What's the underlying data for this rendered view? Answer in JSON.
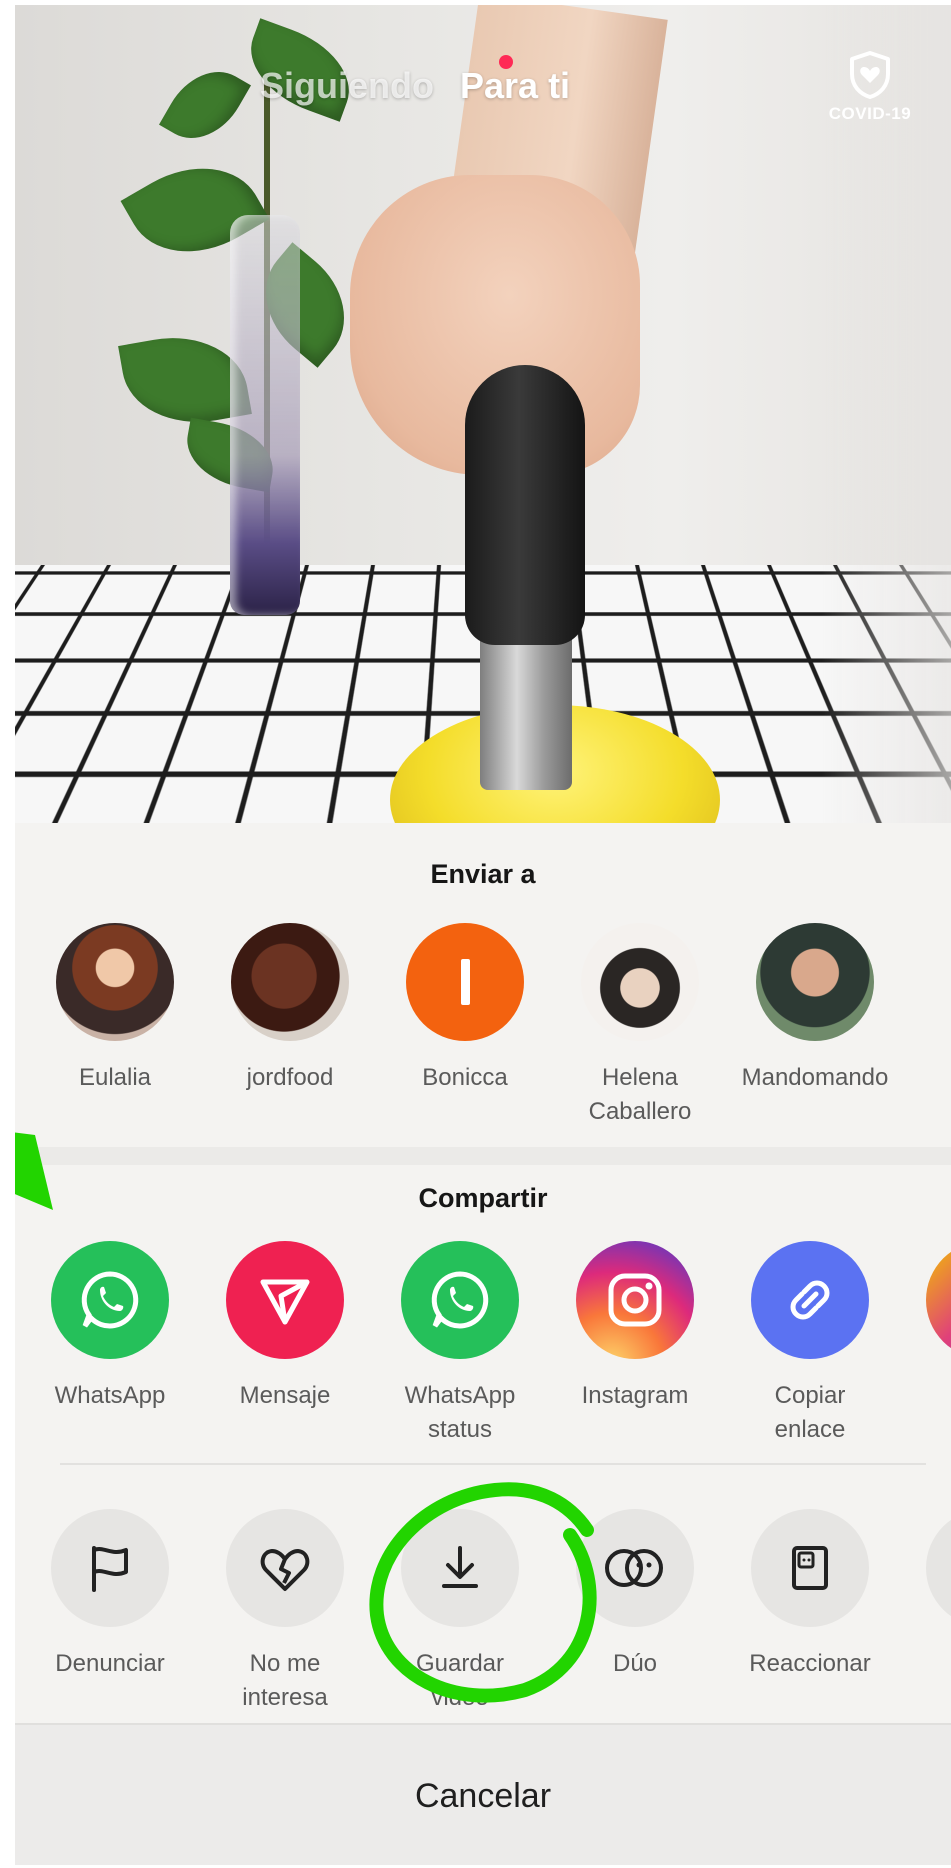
{
  "top_nav": {
    "following": "Siguiendo",
    "for_you": "Para ti",
    "covid_label": "COVID-19"
  },
  "share_sheet": {
    "send_to_title": "Enviar a",
    "contacts": [
      {
        "name": "Eulalia"
      },
      {
        "name": "jordfood"
      },
      {
        "name": "Bonicca"
      },
      {
        "name": "Helena Caballero"
      },
      {
        "name": "Mandomando"
      }
    ],
    "share_title": "Compartir",
    "share_apps": [
      {
        "label": "WhatsApp",
        "icon": "whatsapp-icon",
        "color": "#25c05a"
      },
      {
        "label": "Mensaje",
        "icon": "send-message-icon",
        "color": "#ef2151"
      },
      {
        "label": "WhatsApp status",
        "icon": "whatsapp-icon",
        "color": "#25c05a"
      },
      {
        "label": "Instagram",
        "icon": "instagram-icon",
        "color": "#d6249f"
      },
      {
        "label": "Copiar enlace",
        "icon": "link-icon",
        "color": "#5b72f2"
      }
    ],
    "actions": [
      {
        "label": "Denunciar",
        "icon": "flag-icon"
      },
      {
        "label": "No me interesa",
        "icon": "broken-heart-icon"
      },
      {
        "label": "Guardar video",
        "icon": "download-icon"
      },
      {
        "label": "Dúo",
        "icon": "duet-icon"
      },
      {
        "label": "Reaccionar",
        "icon": "react-icon"
      }
    ],
    "cancel": "Cancelar"
  },
  "colors": {
    "annotation_green": "#22d400",
    "bonicca_avatar": "#f3620f",
    "notification_dot": "#ff2a55"
  }
}
